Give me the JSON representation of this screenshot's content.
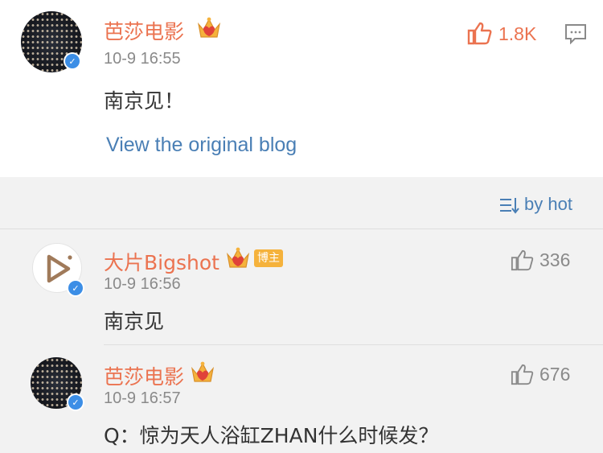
{
  "post": {
    "author": "芭莎电影",
    "time": "10-9 16:55",
    "likes": "1.8K",
    "text": "南京见！",
    "view_original": "View the original blog"
  },
  "sort": {
    "label": "by hot"
  },
  "comments": [
    {
      "author": "大片Bigshot",
      "badge": "博主",
      "time": "10-9 16:56",
      "likes": "336",
      "text": "南京见"
    },
    {
      "author": "芭莎电影",
      "time": "10-9 16:57",
      "likes": "676",
      "text": "Q：惊为天人浴缸ZHAN什么时候发？"
    }
  ],
  "colors": {
    "name": "#eb7350",
    "link": "#4a7fb5",
    "verified": "#3c8ee6",
    "badge": "#f5b23c"
  },
  "icons": [
    "verified-icon",
    "crown-vip-icon",
    "thumbs-up-icon",
    "comment-icon",
    "sort-icon",
    "play-logo-icon"
  ]
}
